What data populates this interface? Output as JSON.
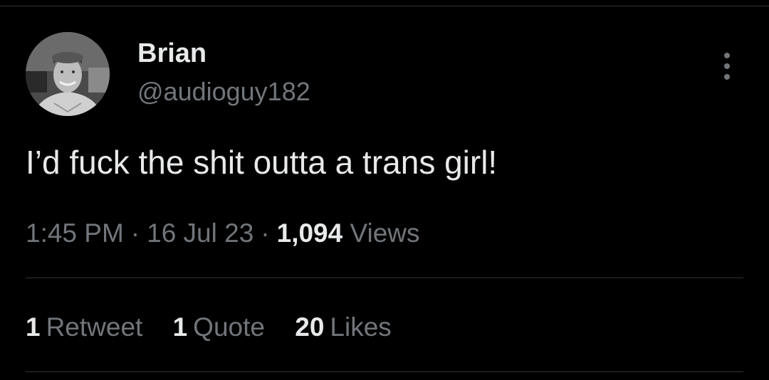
{
  "tweet": {
    "author": {
      "name": "Brian",
      "handle": "@audioguy182",
      "avatar_icon": "profile-photo"
    },
    "more_icon": "more-vertical-icon",
    "text": "I’d fuck the shit outta a trans girl!",
    "meta": {
      "time": "1:45 PM",
      "date": "16 Jul 23",
      "views_count": "1,094",
      "views_label": "Views",
      "separator": "·"
    },
    "stats": [
      {
        "count": "1",
        "label": "Retweet"
      },
      {
        "count": "1",
        "label": "Quote"
      },
      {
        "count": "20",
        "label": "Likes"
      }
    ]
  },
  "colors": {
    "background": "#000000",
    "primary_text": "#e7e9ea",
    "secondary_text": "#71767b",
    "divider": "#2f3336"
  }
}
